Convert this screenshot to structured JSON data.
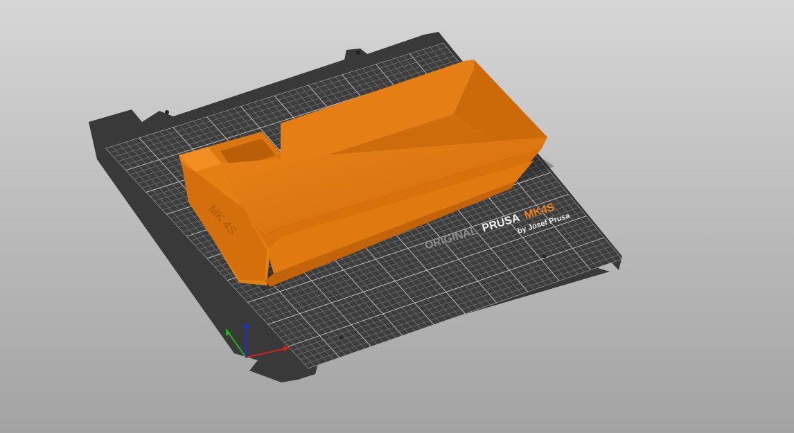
{
  "bed": {
    "logo_prefix": "ORIGINAL",
    "logo_brand": "PRUSA",
    "logo_model": "MK4S",
    "logo_byline": "by Josef Prusa"
  },
  "model": {
    "embossed_text": "MK 4S"
  },
  "colors": {
    "background_top": "#d6d6d6",
    "background_bottom": "#a3a3a3",
    "bed_sheet": "#393939",
    "grid_line": "#8a8a8a",
    "model_orange": "#e07a10",
    "model_orange_dark": "#b85f08",
    "model_orange_light": "#ef8a1f",
    "logo_grey": "#8c8c8c",
    "logo_white": "#f0f0f0",
    "logo_orange": "#f07f1a",
    "axis_x": "#d62020",
    "axis_y": "#20b020",
    "axis_z": "#2030d0"
  },
  "axes_gizmo": {
    "x_icon": "x-axis-arrow",
    "y_icon": "y-axis-arrow",
    "z_icon": "z-axis-arrow"
  }
}
